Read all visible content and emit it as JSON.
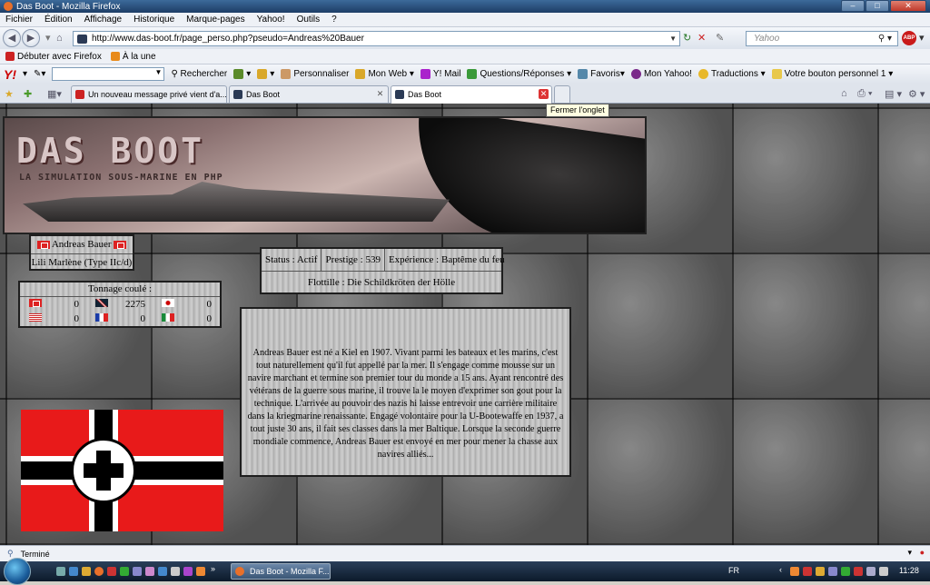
{
  "window": {
    "title": "Das Boot - Mozilla Firefox"
  },
  "menu": [
    "Fichier",
    "Édition",
    "Affichage",
    "Historique",
    "Marque-pages",
    "Yahoo!",
    "Outils",
    "?"
  ],
  "nav": {
    "url": "http://www.das-boot.fr/page_perso.php?pseudo=Andreas%20Bauer",
    "search_placeholder": "Yahoo",
    "abp": "ABP"
  },
  "bookmarks": [
    "Débuter avec Firefox",
    "À la une"
  ],
  "yahoo_toolbar": {
    "logo": "Y!",
    "search": "Rechercher",
    "items": [
      "Personnaliser",
      "Mon Web",
      "Y! Mail",
      "Questions/Réponses",
      "Favoris",
      "Mon Yahoo!",
      "Traductions",
      "Votre bouton personnel 1"
    ]
  },
  "tabs": [
    {
      "label": "Un nouveau message privé vient d'a...",
      "active": false
    },
    {
      "label": "Das Boot",
      "active": false
    },
    {
      "label": "Das Boot",
      "active": true
    }
  ],
  "tooltip": "Fermer l'onglet",
  "page": {
    "banner": {
      "title": "DAS BOOT",
      "subtitle": "LA SIMULATION SOUS-MARINE EN PHP"
    },
    "captain": {
      "name": "Andreas Bauer",
      "submarine": "Lili Marlène (Type IIc/d)"
    },
    "tonnage": {
      "title": "Tonnage coulé :",
      "rows": [
        [
          {
            "flag": "germany",
            "value": "0"
          },
          {
            "flag": "uk",
            "value": "2275"
          },
          {
            "flag": "japan",
            "value": "0"
          }
        ],
        [
          {
            "flag": "usa",
            "value": "0"
          },
          {
            "flag": "france",
            "value": "0"
          },
          {
            "flag": "italy",
            "value": "0"
          }
        ]
      ]
    },
    "status": {
      "status": "Status : Actif",
      "prestige": "Prestige : 539",
      "experience": "Expérience : Baptême du feu",
      "flottille": "Flottille : Die Schildkröten der Hölle"
    },
    "bio": "Andreas Bauer est né a Kiel en 1907. Vivant parmi les bateaux et les marins, c'est tout naturellement qu'il fut appellé par la mer. Il s'engage comme mousse sur un navire marchant et termine son premier tour du monde a 15 ans. Ayant rencontré des vétérans de la guerre sous marine, il trouve la le moyen d'exprimer son gout pour la technique. L'arrivée au pouvoir des nazis hi laisse entrevoir une carrière militaire dans la kriegmarine renaissante. Engagé volontaire pour la U-Bootewaffe en 1937, a tout juste 30 ans, il fait ses classes dans la mer Baltique. Lorsque la seconde guerre mondiale commence, Andreas Bauer est envoyé en mer pour mener la chasse aux navires alliés..."
  },
  "statusbar": {
    "text": "Terminé"
  },
  "taskbar": {
    "window": "Das Boot - Mozilla F...",
    "lang": "FR",
    "time": "11:28"
  },
  "colors": {
    "accent": "#3c6a9a",
    "flag_red": "#e81a1a"
  }
}
